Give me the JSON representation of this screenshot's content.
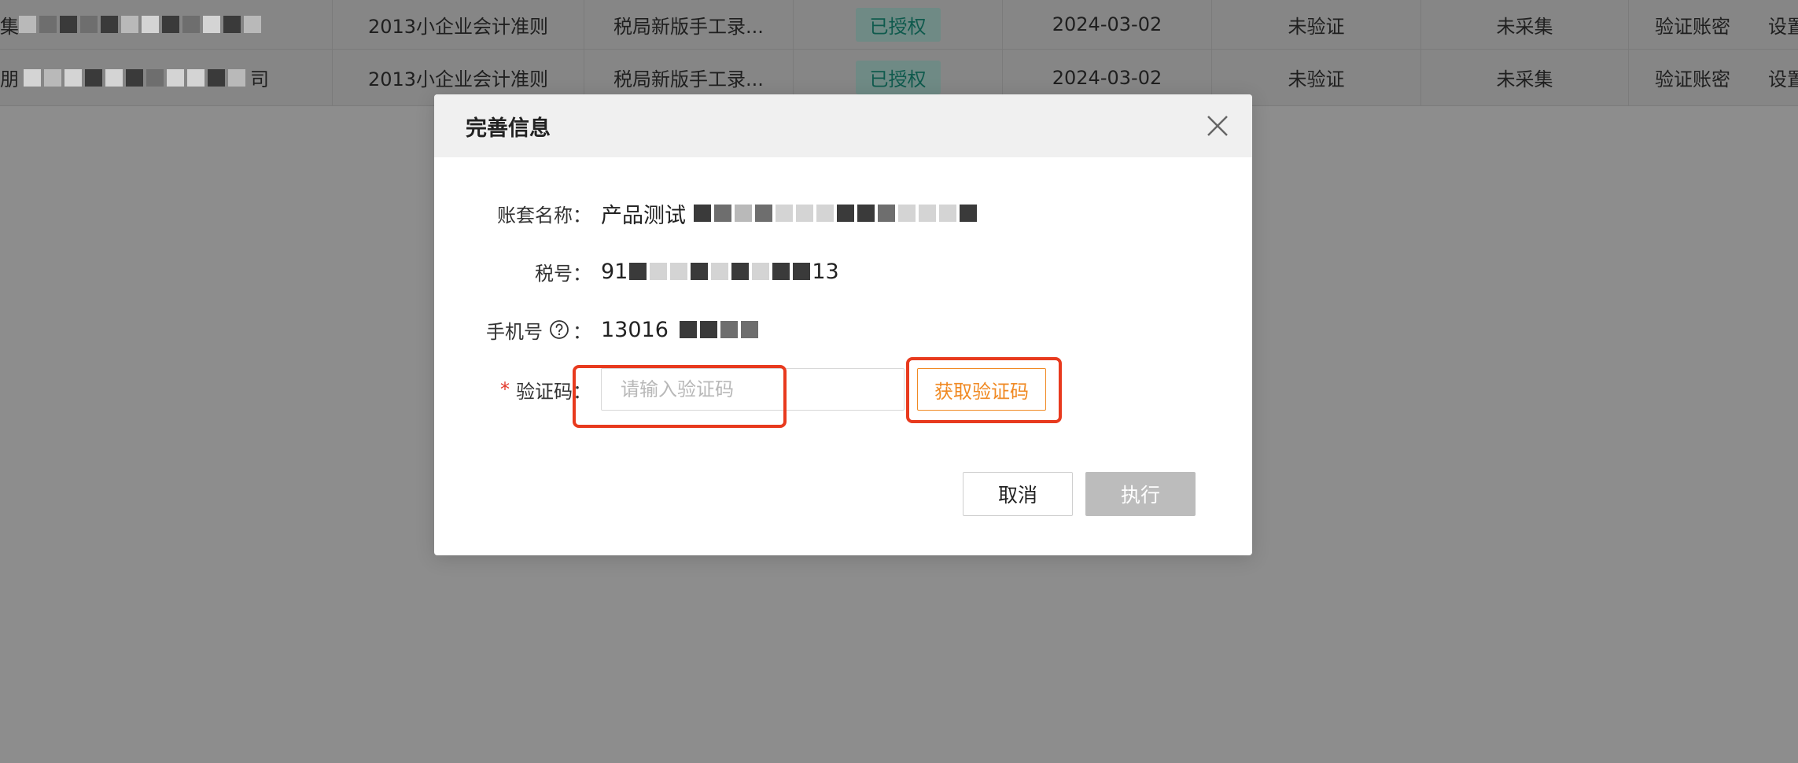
{
  "table": {
    "rows": [
      {
        "name_suffix": "",
        "name_prefix": "集",
        "standard": "2013小企业会计准则",
        "source": "税局新版手工录...",
        "auth": "已授权",
        "date": "2024-03-02",
        "verify": "未验证",
        "collect": "未采集",
        "action1": "验证账密",
        "action2": "设置"
      },
      {
        "name_prefix": "朋",
        "name_suffix": "司",
        "standard": "2013小企业会计准则",
        "source": "税局新版手工录...",
        "auth": "已授权",
        "date": "2024-03-02",
        "verify": "未验证",
        "collect": "未采集",
        "action1": "验证账密",
        "action2": "设置"
      }
    ]
  },
  "modal": {
    "title": "完善信息",
    "fields": {
      "account_label": "账套名称：",
      "account_value": "产品测试",
      "tax_label": "税号：",
      "tax_prefix": "91",
      "tax_suffix": "13",
      "phone_label": "手机号",
      "phone_colon": "：",
      "phone_value": "13016",
      "code_required": "*",
      "code_label": "验证码：",
      "code_placeholder": "请输入验证码"
    },
    "get_code_label": "获取验证码",
    "cancel_label": "取消",
    "execute_label": "执行"
  },
  "colors": {
    "accent": "#f08a24",
    "highlight": "#e83a1e",
    "required": "#e23a2c",
    "auth_badge_text": "#0f5a4d",
    "disabled_button": "#bcbcbc"
  },
  "icons": {
    "close": "close-icon",
    "help": "question-circle-icon"
  }
}
